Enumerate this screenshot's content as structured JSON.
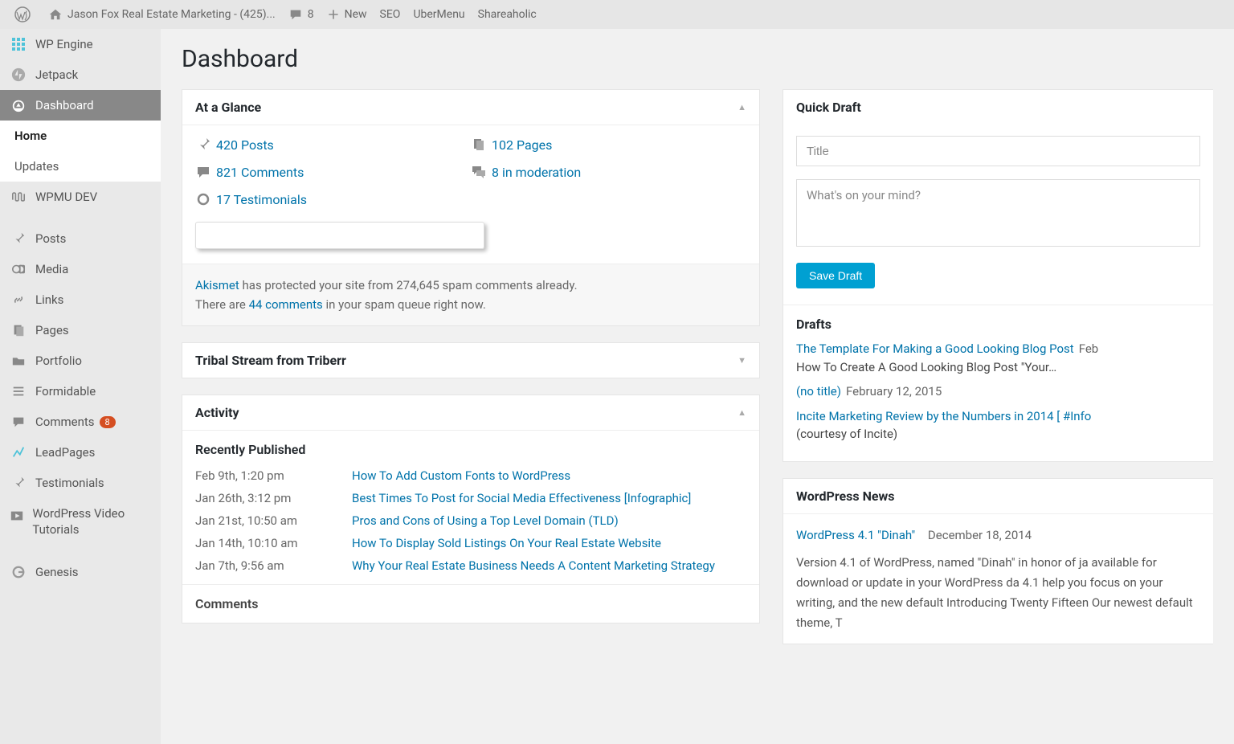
{
  "adminbar": {
    "site_title": "Jason Fox Real Estate Marketing - (425)...",
    "comments_count": "8",
    "new_label": "New",
    "items": [
      "SEO",
      "UberMenu",
      "Shareaholic"
    ]
  },
  "sidebar": {
    "items": [
      {
        "label": "WP Engine"
      },
      {
        "label": "Jetpack"
      },
      {
        "label": "Dashboard"
      },
      {
        "label": "Home"
      },
      {
        "label": "Updates"
      },
      {
        "label": "WPMU DEV"
      },
      {
        "label": "Posts"
      },
      {
        "label": "Media"
      },
      {
        "label": "Links"
      },
      {
        "label": "Pages"
      },
      {
        "label": "Portfolio"
      },
      {
        "label": "Formidable"
      },
      {
        "label": "Comments",
        "badge": "8"
      },
      {
        "label": "LeadPages"
      },
      {
        "label": "Testimonials"
      },
      {
        "label": "WordPress Video Tutorials"
      },
      {
        "label": "Genesis"
      }
    ]
  },
  "page_title": "Dashboard",
  "glance": {
    "title": "At a Glance",
    "posts": "420 Posts",
    "pages": "102 Pages",
    "comments": "821 Comments",
    "moderation": "8 in moderation",
    "testimonials": "17 Testimonials",
    "akismet_link": "Akismet",
    "akismet_text1": " has protected your site from 274,645 spam comments already.",
    "akismet_text2a": "There are ",
    "akismet_link2": "44 comments",
    "akismet_text2b": " in your spam queue right now."
  },
  "tribal": {
    "title": "Tribal Stream from Triberr"
  },
  "activity": {
    "title": "Activity",
    "recent_title": "Recently Published",
    "rows": [
      {
        "date": "Feb 9th, 1:20 pm",
        "title": "How To Add Custom Fonts to WordPress"
      },
      {
        "date": "Jan 26th, 3:12 pm",
        "title": "Best Times To Post for Social Media Effectiveness [Infographic]"
      },
      {
        "date": "Jan 21st, 10:50 am",
        "title": "Pros and Cons of Using a Top Level Domain (TLD)"
      },
      {
        "date": "Jan 14th, 10:10 am",
        "title": "How To Display Sold Listings On Your Real Estate Website"
      },
      {
        "date": "Jan 7th, 9:56 am",
        "title": "Why Your Real Estate Business Needs A Content Marketing Strategy"
      }
    ],
    "comments_title": "Comments"
  },
  "quickdraft": {
    "title": "Quick Draft",
    "title_placeholder": "Title",
    "content_placeholder": "What's on your mind?",
    "save_label": "Save Draft",
    "drafts_title": "Drafts",
    "drafts": [
      {
        "link": "The Template For Making a Good Looking Blog Post",
        "meta": "Feb",
        "excerpt": "How To Create A Good Looking Blog Post   \"Your…"
      },
      {
        "link": "(no title)",
        "meta": "February 12, 2015"
      },
      {
        "link": "Incite Marketing Review by the Numbers in 2014 [ #Info",
        "excerpt": "  (courtesy of Incite)"
      }
    ]
  },
  "news": {
    "title": "WordPress News",
    "headline": "WordPress 4.1 \"Dinah\"",
    "date": "December 18, 2014",
    "body": "Version 4.1 of WordPress, named \"Dinah\" in honor of ja available for download or update in your WordPress da 4.1 help you focus on your writing, and the new default Introducing Twenty Fifteen Our newest default theme, T"
  }
}
